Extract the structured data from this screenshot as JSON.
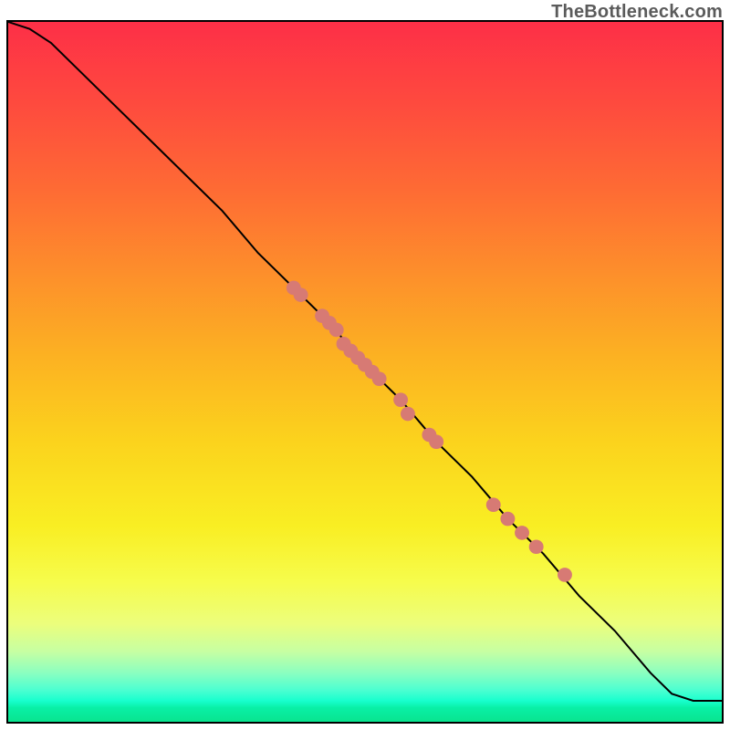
{
  "watermark": {
    "text": "TheBottleneck.com"
  },
  "chart_data": {
    "type": "line",
    "title": "",
    "xlabel": "",
    "ylabel": "",
    "xlim": [
      0,
      100
    ],
    "ylim": [
      0,
      100
    ],
    "grid": false,
    "legend": false,
    "series": [
      {
        "name": "curve",
        "color": "#000000",
        "x": [
          0,
          3,
          6,
          10,
          15,
          20,
          25,
          30,
          35,
          40,
          45,
          50,
          55,
          60,
          65,
          70,
          75,
          80,
          85,
          90,
          93,
          96,
          100
        ],
        "y": [
          100,
          99,
          97,
          93,
          88,
          83,
          78,
          73,
          67,
          62,
          57,
          51,
          46,
          40,
          35,
          29,
          24,
          18,
          13,
          7,
          4,
          3,
          3
        ]
      }
    ],
    "markers": {
      "name": "highlighted-points",
      "color": "#d77a74",
      "radius": 8,
      "points": [
        {
          "x": 40,
          "y": 62
        },
        {
          "x": 41,
          "y": 61
        },
        {
          "x": 44,
          "y": 58
        },
        {
          "x": 45,
          "y": 57
        },
        {
          "x": 46,
          "y": 56
        },
        {
          "x": 47,
          "y": 54
        },
        {
          "x": 48,
          "y": 53
        },
        {
          "x": 49,
          "y": 52
        },
        {
          "x": 50,
          "y": 51
        },
        {
          "x": 51,
          "y": 50
        },
        {
          "x": 52,
          "y": 49
        },
        {
          "x": 55,
          "y": 46
        },
        {
          "x": 56,
          "y": 44
        },
        {
          "x": 59,
          "y": 41
        },
        {
          "x": 60,
          "y": 40
        },
        {
          "x": 68,
          "y": 31
        },
        {
          "x": 70,
          "y": 29
        },
        {
          "x": 72,
          "y": 27
        },
        {
          "x": 74,
          "y": 25
        },
        {
          "x": 78,
          "y": 21
        }
      ]
    },
    "colors": {
      "gradient_top": "#fd2f47",
      "gradient_mid": "#fbd31d",
      "gradient_bottom": "#09e48f",
      "line": "#000000",
      "marker_fill": "#d77a74"
    }
  }
}
